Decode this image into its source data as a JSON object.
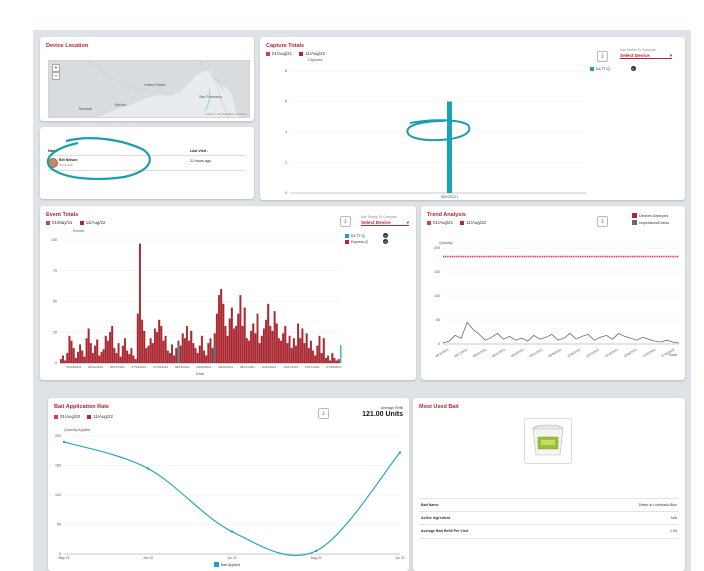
{
  "device_location": {
    "title": "Device Location",
    "map_labels": [
      "United States",
      "Mexico",
      "San Francisco",
      "Mexicali"
    ],
    "zoom_in": "+",
    "zoom_out": "–",
    "attribution": "Leaflet | © OpenStreetMap contributors"
  },
  "visits": {
    "col_name": "Name",
    "col_last_visit": "Last Visit ↓",
    "rows": [
      {
        "name": "Bill Nelson",
        "sub": "Technician",
        "last_visit": "21 hours ago"
      }
    ]
  },
  "capture_totals": {
    "title": "Capture Totals",
    "legend": [
      {
        "label": "01/Aug/21",
        "color": "#d0405a"
      },
      {
        "label": "11/Aug/22",
        "color": "#b3252f"
      }
    ],
    "y_title": "Captures",
    "x_title": "Date",
    "compare_label": "Add Device To Compare",
    "select_value": "Select Device",
    "devices": [
      {
        "label": "D4 TT-Q",
        "color": "#17a3b8"
      }
    ],
    "download_icon": "download-icon",
    "chart_data": {
      "type": "bar",
      "categories": [
        "08/10/2021"
      ],
      "values": [
        6
      ],
      "ylim": [
        0,
        8
      ],
      "yticks": [
        0,
        2,
        4,
        6,
        8
      ],
      "xlabel": "Date",
      "ylabel": "Captures"
    }
  },
  "event_totals": {
    "title": "Event Totals",
    "legend": [
      {
        "label": "01/May/21",
        "color": "#d0405a"
      },
      {
        "label": "11/Aug/22",
        "color": "#b3252f"
      }
    ],
    "y_title": "Events",
    "x_title": "Date",
    "compare_label": "Add Device To Compare",
    "select_value": "Select Device",
    "devices": [
      {
        "label": "D4 TT-Q",
        "color": "#17a3b8"
      },
      {
        "label": "Express-Q",
        "color": "#b3252f"
      }
    ],
    "chart_data": {
      "type": "bar",
      "ylim": [
        0,
        100
      ],
      "yticks": [
        0,
        25,
        50,
        75,
        100
      ],
      "xlabel": "Date",
      "ylabel": "Events",
      "tick_labels": [
        "05/18/2021",
        "06/12/2021",
        "06/27/2021",
        "07/19/2021",
        "07/29/2021",
        "08/13/2021",
        "08/28/2021",
        "09/12/2021",
        "09/27/2021",
        "10/12/2021",
        "10/27/2021",
        "11/17/2021",
        "07/28/2022"
      ],
      "series": [
        {
          "name": "Express-Q",
          "color": "#b3252f",
          "values": [
            3,
            6,
            2,
            8,
            22,
            18,
            12,
            4,
            9,
            15,
            10,
            5,
            20,
            28,
            16,
            8,
            14,
            19,
            6,
            9,
            11,
            22,
            18,
            25,
            30,
            12,
            8,
            16,
            5,
            14,
            20,
            10,
            7,
            12,
            6,
            3,
            40,
            97,
            35,
            26,
            12,
            14,
            20,
            16,
            28,
            25,
            35,
            30,
            18,
            22,
            10,
            8,
            15,
            6,
            12,
            18,
            14,
            24,
            20,
            30,
            18,
            26,
            16,
            12,
            8,
            14,
            22,
            10,
            6,
            16,
            20,
            12,
            24,
            40,
            55,
            60,
            48,
            30,
            22,
            36,
            45,
            28,
            30,
            40,
            55,
            30,
            45,
            20,
            18,
            26,
            32,
            24,
            40,
            16,
            22,
            28,
            35,
            48,
            30,
            26,
            42,
            32,
            20,
            18,
            24,
            30,
            16,
            22,
            12,
            20,
            14,
            32,
            20,
            28,
            16,
            24,
            12,
            18,
            10,
            6,
            14,
            22,
            8,
            20,
            4,
            6,
            2,
            8,
            4,
            2,
            3
          ]
        },
        {
          "name": "D4 TT-Q",
          "color": "#17a3b8",
          "values": [
            0,
            0,
            0,
            0,
            0,
            0,
            0,
            0,
            0,
            0,
            0,
            0,
            0,
            0,
            0,
            0,
            0,
            0,
            0,
            0,
            0,
            0,
            0,
            0,
            0,
            0,
            0,
            0,
            0,
            0,
            0,
            0,
            0,
            0,
            0,
            0,
            0,
            0,
            0,
            0,
            0,
            0,
            0,
            0,
            0,
            0,
            0,
            0,
            0,
            0,
            0,
            0,
            0,
            0,
            0,
            0,
            0,
            0,
            0,
            0,
            0,
            0,
            0,
            0,
            0,
            0,
            0,
            0,
            0,
            0,
            0,
            0,
            0,
            0,
            0,
            0,
            0,
            0,
            0,
            0,
            0,
            0,
            0,
            0,
            0,
            0,
            0,
            0,
            0,
            0,
            0,
            0,
            0,
            0,
            0,
            0,
            0,
            0,
            0,
            0,
            0,
            0,
            0,
            0,
            0,
            0,
            0,
            0,
            0,
            0,
            0,
            0,
            0,
            0,
            0,
            0,
            0,
            0,
            0,
            0,
            0,
            0,
            0,
            0,
            0,
            0,
            0,
            0,
            0,
            0,
            0
          ]
        }
      ]
    }
  },
  "trend_analysis": {
    "title": "Trend Analysis",
    "legend": [
      {
        "label": "01/Aug/21",
        "color": "#d0405a"
      },
      {
        "label": "11/Aug/22",
        "color": "#b3252f"
      }
    ],
    "right_legend": [
      {
        "label": "Devices Deployed",
        "color": "#b3252f"
      },
      {
        "label": "Inspections/Events",
        "color": "#6b6b6b"
      }
    ],
    "y_title": "Quantity",
    "x_title": "Date",
    "chart_data": {
      "type": "line",
      "ylim": [
        0,
        200
      ],
      "yticks": [
        0,
        50,
        100,
        150,
        200
      ],
      "tick_labels": [
        "08/10/2021",
        "08/17/2021",
        "08/24/2021",
        "08/31/2021",
        "09/14/2021",
        "09/21/2021",
        "09/28/2021",
        "10/05/2021",
        "10/12/2021",
        "10/19/2021",
        "10/26/2021",
        "11/02/2021",
        "07/28/2022"
      ],
      "series": [
        {
          "name": "Devices Deployed",
          "color": "#d0405a",
          "values": [
            182,
            182,
            182,
            182,
            182,
            182,
            182,
            182,
            182,
            182,
            182,
            182,
            182,
            182,
            182,
            182,
            182,
            182,
            182,
            182,
            182,
            182,
            182,
            182,
            182,
            182,
            182,
            182,
            182,
            182,
            182,
            182,
            182,
            182,
            182,
            182,
            182,
            182,
            182,
            182
          ]
        },
        {
          "name": "Inspections/Events",
          "color": "#6b6b6b",
          "values": [
            2,
            6,
            18,
            12,
            45,
            30,
            20,
            8,
            14,
            22,
            10,
            16,
            8,
            12,
            6,
            18,
            10,
            14,
            20,
            8,
            12,
            22,
            10,
            16,
            20,
            8,
            14,
            18,
            10,
            22,
            16,
            12,
            8,
            14,
            10,
            6,
            4,
            8,
            4,
            2
          ]
        }
      ]
    }
  },
  "bait_rate": {
    "title": "Bait Application Rate",
    "legend": [
      {
        "label": "01/Aug/20",
        "color": "#d0405a"
      },
      {
        "label": "11/Aug/22",
        "color": "#b3252f"
      }
    ],
    "avg_label": "Average Refill",
    "avg_value": "121.00 Units",
    "y_title": "Quantity Applied",
    "series_label": "Bait Applied",
    "chart_data": {
      "type": "line",
      "categories": [
        "May 22",
        "Jun 22",
        "Jul 22",
        "Aug 22",
        "Jul 22"
      ],
      "values": [
        190,
        145,
        38,
        5,
        172
      ],
      "ylim": [
        0,
        200
      ],
      "yticks": [
        0,
        50,
        100,
        150,
        200
      ],
      "series": [
        {
          "name": "Bait Applied",
          "color": "#17a3b8"
        }
      ]
    }
  },
  "most_used_bait": {
    "title": "Most Used Bait",
    "rows": [
      {
        "label": "Bait Name",
        "value": "Detex or Lumitrack Bloc"
      },
      {
        "label": "Active Ingredient",
        "value": "N/A"
      },
      {
        "label": "Average Bait Refill Per Visit",
        "value": "1.94"
      }
    ]
  }
}
